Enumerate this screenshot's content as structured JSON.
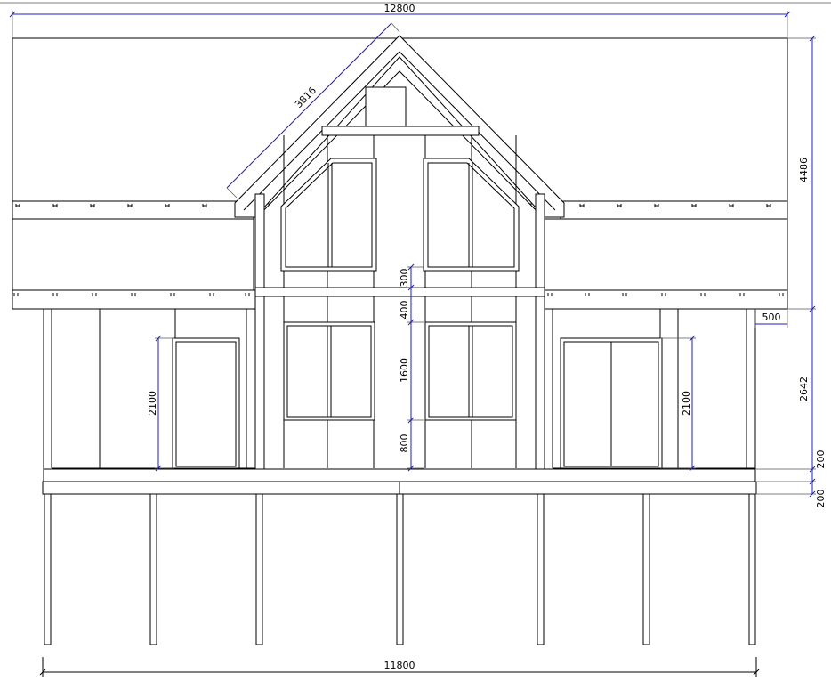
{
  "dimensions": {
    "overall_roof_width": "12800",
    "gable_slope_length": "3816",
    "total_height_above_wall": "4486",
    "roof_overhang": "500",
    "first_floor_height": "2642",
    "door_left_height": "2100",
    "door_right_height": "2100",
    "window_sill_height": "800",
    "window_height": "1600",
    "above_window": "400",
    "upper_sill": "300",
    "floor_thickness": "200",
    "plinth_thickness": "200",
    "foundation_width": "11800"
  },
  "colors": {
    "lines": "#000000",
    "dimension_lines": "#1d1dc4"
  }
}
